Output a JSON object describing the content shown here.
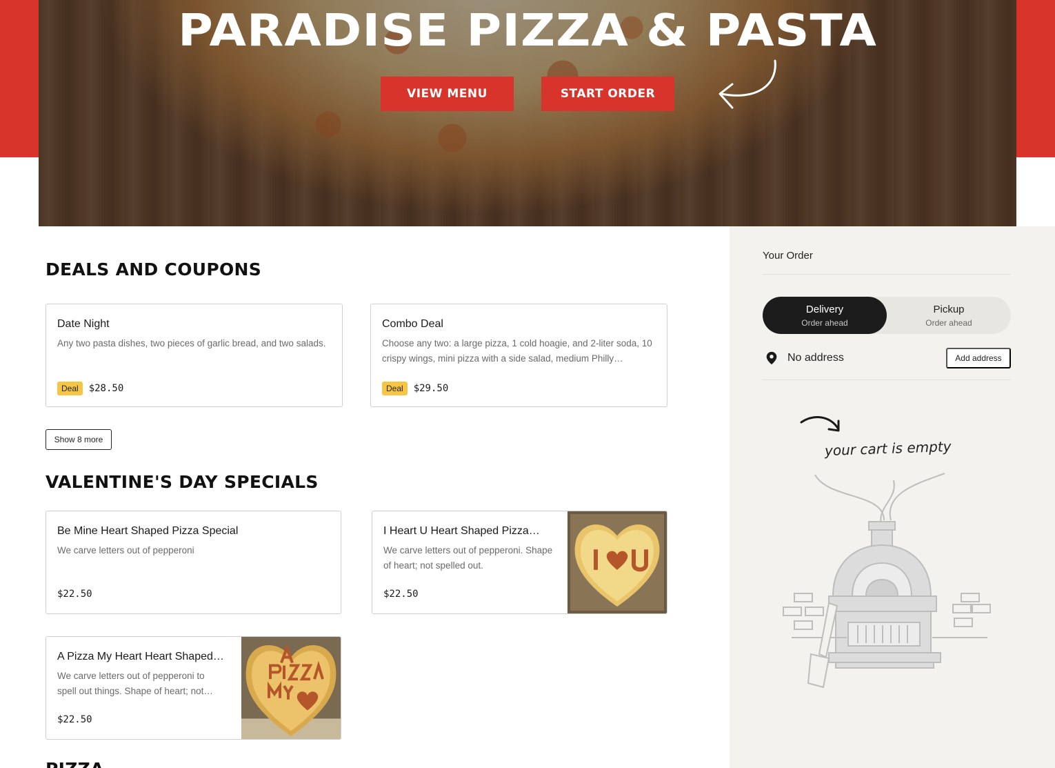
{
  "hero": {
    "title": "PARADISE PIZZA & PASTA",
    "view_menu": "VIEW MENU",
    "start_order": "START ORDER"
  },
  "deals": {
    "heading": "DEALS AND COUPONS",
    "items": [
      {
        "title": "Date Night",
        "desc": "Any two pasta dishes, two pieces of garlic bread, and two salads.",
        "badge": "Deal",
        "price": "$28.50"
      },
      {
        "title": "Combo Deal",
        "desc": "Choose any two: a large pizza, 1 cold hoagie, and 2-liter soda, 10 crispy wings, mini pizza with a side salad, medium Philly…",
        "badge": "Deal",
        "price": "$29.50"
      }
    ],
    "show_more": "Show 8 more"
  },
  "valentines": {
    "heading": "VALENTINE'S DAY SPECIALS",
    "items": [
      {
        "title": "Be Mine Heart Shaped Pizza Special",
        "desc": "We carve letters out of pepperoni",
        "price": "$22.50"
      },
      {
        "title": "I Heart U Heart Shaped Pizza…",
        "desc": "We carve letters out of pepperoni. Shape of heart; not spelled out.",
        "price": "$22.50"
      },
      {
        "title": "A Pizza My Heart Heart Shaped…",
        "desc": "We carve letters out of pepperoni to spell out things. Shape of heart; not…",
        "price": "$22.50"
      }
    ]
  },
  "next_section_partial": "PIZZA",
  "sidebar": {
    "title": "Your Order",
    "delivery": {
      "label": "Delivery",
      "sub": "Order ahead"
    },
    "pickup": {
      "label": "Pickup",
      "sub": "Order ahead"
    },
    "no_address": "No address",
    "add_address": "Add address",
    "empty_cart": "your cart is empty"
  },
  "colors": {
    "brand_red": "#d9342b",
    "deal_yellow": "#f6c544",
    "sidebar_bg": "#f3f2ee",
    "toggle_active": "#1c1c1c"
  }
}
